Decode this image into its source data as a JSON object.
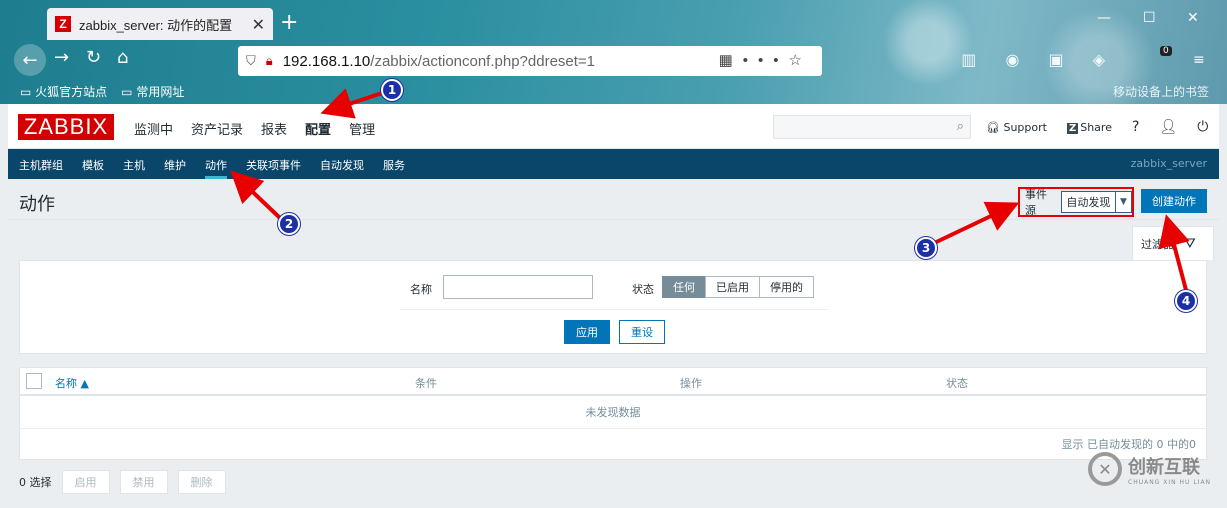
{
  "browser": {
    "tab_title": "zabbix_server: 动作的配置",
    "tab_favicon": "Z",
    "new_tab": "+",
    "url_host": "192.168.1.10",
    "url_path": "/zabbix/actionconf.php?ddreset=1",
    "bookmarks": [
      "火狐官方站点",
      "常用网址"
    ],
    "bookmarks_right": "移动设备上的书签",
    "ext_badge": "0"
  },
  "header": {
    "logo": "ZABBIX",
    "menu": [
      "监测中",
      "资产记录",
      "报表",
      "配置",
      "管理"
    ],
    "support": "Support",
    "share": "Share",
    "help": "?",
    "share_badge": "Z"
  },
  "subnav": {
    "items": [
      "主机群组",
      "模板",
      "主机",
      "维护",
      "动作",
      "关联项事件",
      "自动发现",
      "服务"
    ],
    "server": "zabbix_server"
  },
  "main": {
    "title": "动作",
    "event_source_label": "事件源",
    "event_source_value": "自动发现",
    "create_button": "创建动作",
    "filter_tab": "过滤器"
  },
  "filter": {
    "name_label": "名称",
    "name_value": "",
    "status_label": "状态",
    "status_options": [
      "任何",
      "已启用",
      "停用的"
    ],
    "status_selected": "任何",
    "apply": "应用",
    "reset": "重设"
  },
  "table": {
    "columns": [
      "名称 ▲",
      "条件",
      "操作",
      "状态"
    ],
    "empty": "未发现数据",
    "count": "显示 已自动发现的 0 中的0"
  },
  "footer": {
    "selected": "0 选择",
    "buttons": [
      "启用",
      "禁用",
      "删除"
    ]
  },
  "annotations": [
    "1",
    "2",
    "3",
    "4"
  ],
  "watermark": {
    "text": "创新互联",
    "sub": "CHUANG XIN HU LIAN"
  },
  "colors": {
    "brand": "#d40000",
    "nav": "#0a466a",
    "primary": "#0275b8",
    "annotation": "#1c2fa5",
    "arrow": "#e60000"
  }
}
